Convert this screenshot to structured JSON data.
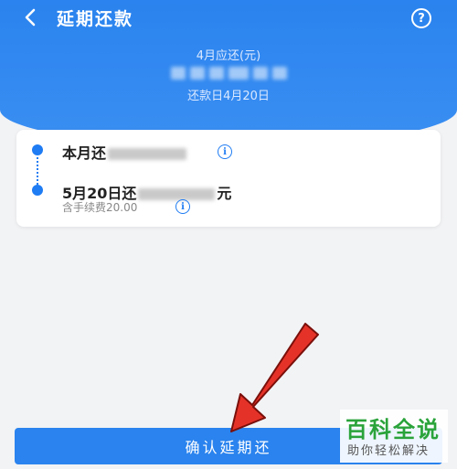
{
  "nav": {
    "title": "延期还款",
    "help_label": "?"
  },
  "summary": {
    "due_label": "4月应还(元)",
    "due_date": "还款日4月20日"
  },
  "card": {
    "row1_prefix": "本月还",
    "row2_prefix": "5月20日还",
    "row2_suffix": "元",
    "fee_text": "含手续费20.00",
    "info_glyph": "i"
  },
  "actions": {
    "confirm_label": "确认延期还"
  },
  "watermark": {
    "top": "百科全说",
    "bottom": "助你轻松解决"
  },
  "colors": {
    "primary": "#2a83ee",
    "arrow": "#e53228",
    "watermark_green": "#2aa33a"
  }
}
